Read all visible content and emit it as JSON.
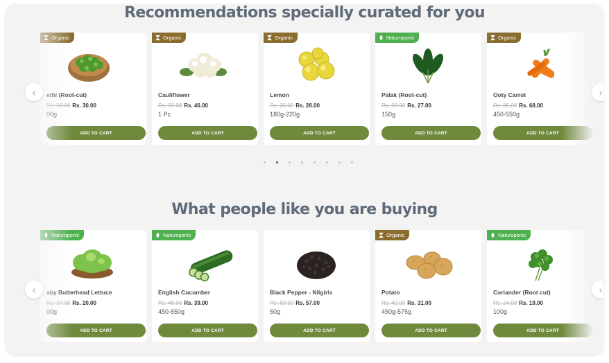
{
  "section1": {
    "title": "Recommendations specially curated for you",
    "products": [
      {
        "badge": "Organic",
        "badge_type": "organic",
        "image": "methi-bunch-icon",
        "name": "ethi (Root-cut)",
        "old_price": "Rs. 36.00",
        "new_price": "Rs. 30.00",
        "qty": "00g",
        "button": "ADD TO CART"
      },
      {
        "badge": "Organic",
        "badge_type": "organic",
        "image": "cauliflower-icon",
        "name": "Cauliflower",
        "old_price": "Rs. 55.00",
        "new_price": "Rs. 46.00",
        "qty": "1 Pc",
        "button": "ADD TO CART"
      },
      {
        "badge": "Organic",
        "badge_type": "organic",
        "image": "lemon-icon",
        "name": "Lemon",
        "old_price": "Rs. 35.00",
        "new_price": "Rs. 28.00",
        "qty": "180g-220g",
        "button": "ADD TO CART"
      },
      {
        "badge": "Naturoponic",
        "badge_type": "naturoponic",
        "image": "spinach-icon",
        "name": "Palak (Root-cut)",
        "old_price": "Rs. 32.00",
        "new_price": "Rs. 27.00",
        "qty": "150g",
        "button": "ADD TO CART"
      },
      {
        "badge": "Organic",
        "badge_type": "organic",
        "image": "carrot-icon",
        "name": "Ooty Carrot",
        "old_price": "Rs. 85.00",
        "new_price": "Rs. 68.00",
        "qty": "450-550g",
        "button": "ADD TO CART"
      }
    ],
    "dots_count": 8,
    "active_dot": 1
  },
  "section2": {
    "title": "What people like you are buying",
    "products": [
      {
        "badge": "Naturoponic",
        "badge_type": "naturoponic",
        "image": "lettuce-icon",
        "name": "aby Butterhead Lettuce",
        "old_price": "Rs. 27.00",
        "new_price": "Rs. 20.00",
        "qty": "00g",
        "button": "ADD TO CART"
      },
      {
        "badge": "Naturoponic",
        "badge_type": "naturoponic",
        "image": "cucumber-icon",
        "name": "English Cucumber",
        "old_price": "Rs. 46.00",
        "new_price": "Rs. 39.00",
        "qty": "450-550g",
        "button": "ADD TO CART"
      },
      {
        "badge": "",
        "badge_type": "",
        "image": "black-pepper-icon",
        "name": "Black Pepper - Nilgiris",
        "old_price": "Rs. 69.00",
        "new_price": "Rs. 57.00",
        "qty": "50g",
        "button": "ADD TO CART"
      },
      {
        "badge": "Organic",
        "badge_type": "organic",
        "image": "potato-icon",
        "name": "Potato",
        "old_price": "Rs. 42.00",
        "new_price": "Rs. 31.00",
        "qty": "450g-575g",
        "button": "ADD TO CART"
      },
      {
        "badge": "Naturoponic",
        "badge_type": "naturoponic",
        "image": "coriander-icon",
        "name": "Coriander (Root cut)",
        "old_price": "Rs. 24.00",
        "new_price": "Rs. 19.00",
        "qty": "100g",
        "button": "ADD TO CART"
      }
    ]
  },
  "colors": {
    "button": "#6f8a3d",
    "organic_badge": "#8a6c2f",
    "naturoponic_badge": "#4fb04f",
    "title": "#5f6b78",
    "panel_bg": "#f3f3f3"
  }
}
